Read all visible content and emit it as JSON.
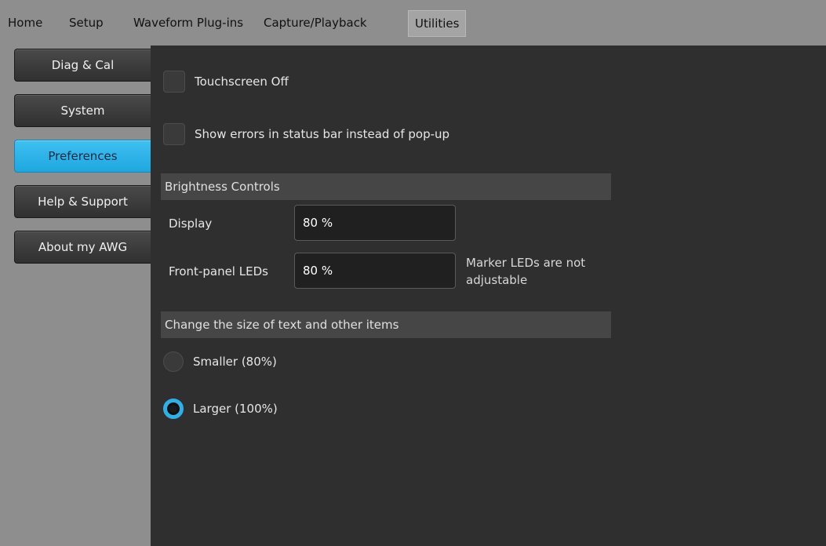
{
  "menu": {
    "items": [
      {
        "label": "Home"
      },
      {
        "label": "Setup"
      },
      {
        "label": "Waveform Plug-ins"
      },
      {
        "label": "Capture/Playback"
      },
      {
        "label": "Utilities",
        "active": true
      }
    ]
  },
  "sidebar": {
    "items": [
      {
        "label": "Diag & Cal"
      },
      {
        "label": "System"
      },
      {
        "label": "Preferences",
        "active": true
      },
      {
        "label": "Help & Support"
      },
      {
        "label": "About my AWG"
      }
    ]
  },
  "preferences": {
    "touchscreen_off": {
      "label": "Touchscreen Off",
      "checked": false
    },
    "show_errors": {
      "label": "Show errors in status bar instead of pop-up",
      "checked": false
    },
    "brightness": {
      "header": "Brightness Controls",
      "display_label": "Display",
      "display_value": "80 %",
      "front_panel_label": "Front-panel LEDs",
      "front_panel_value": "80 %",
      "marker_note_line1": "Marker LEDs are not",
      "marker_note_line2": "adjustable"
    },
    "text_size": {
      "header": "Change the size of text and other items",
      "smaller_label": "Smaller (80%)",
      "larger_label": "Larger (100%)",
      "selected": "larger"
    }
  },
  "colors": {
    "accent": "#2db0e8",
    "menubar": "#8e8e8e",
    "panel": "#2f2f2f"
  }
}
